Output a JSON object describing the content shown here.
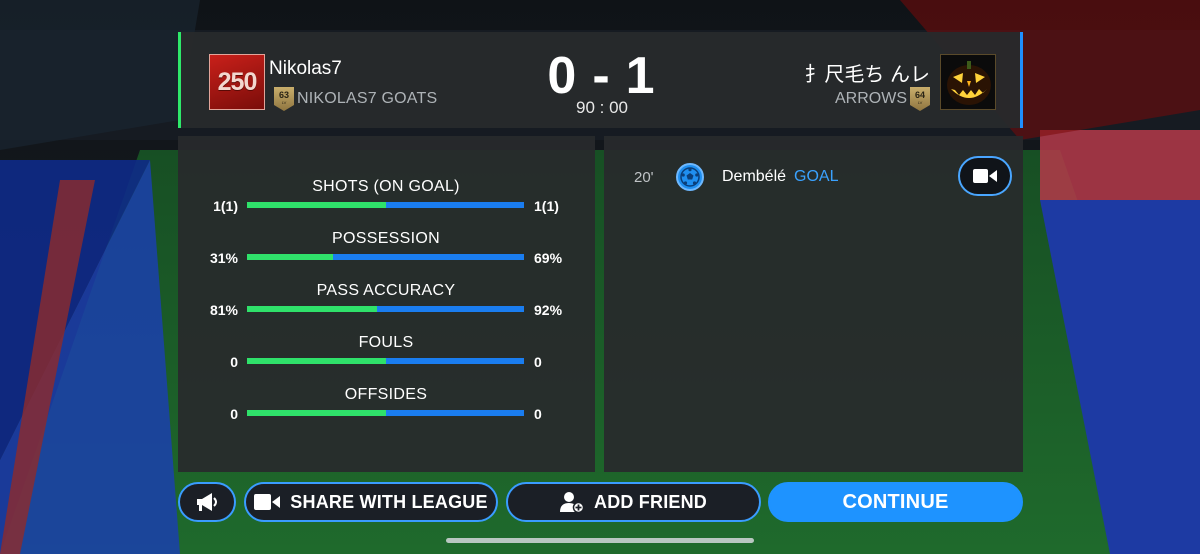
{
  "header": {
    "home": {
      "badge_text": "250",
      "name": "Nikolas7",
      "club": "NIKOLAS7 GOATS",
      "rating": "63",
      "rating_label": "LV"
    },
    "away": {
      "name": "扌尺毛ち  んレ",
      "club": "ARROWS",
      "rating": "64",
      "rating_label": "LV"
    },
    "score_home": "0",
    "score_sep": "-",
    "score_away": "1",
    "clock": "90 : 00"
  },
  "stats": [
    {
      "label": "SHOTS (ON GOAL)",
      "home": "1(1)",
      "away": "1(1)",
      "home_share": 0.5
    },
    {
      "label": "POSSESSION",
      "home": "31%",
      "away": "69%",
      "home_share": 0.31
    },
    {
      "label": "PASS ACCURACY",
      "home": "81%",
      "away": "92%",
      "home_share": 0.47
    },
    {
      "label": "FOULS",
      "home": "0",
      "away": "0",
      "home_share": 0.5
    },
    {
      "label": "OFFSIDES",
      "home": "0",
      "away": "0",
      "home_share": 0.5
    }
  ],
  "events": [
    {
      "minute": "20'",
      "icon": "soccer-ball-icon",
      "player": "Dembélé",
      "type": "GOAL"
    }
  ],
  "buttons": {
    "share": "SHARE WITH LEAGUE",
    "add_friend": "ADD FRIEND",
    "continue": "CONTINUE"
  },
  "colors": {
    "home_accent": "#2ee86a",
    "away_accent": "#1e8fff",
    "goal_text": "#3aa2ff",
    "continue_button": "#1e93ff"
  }
}
